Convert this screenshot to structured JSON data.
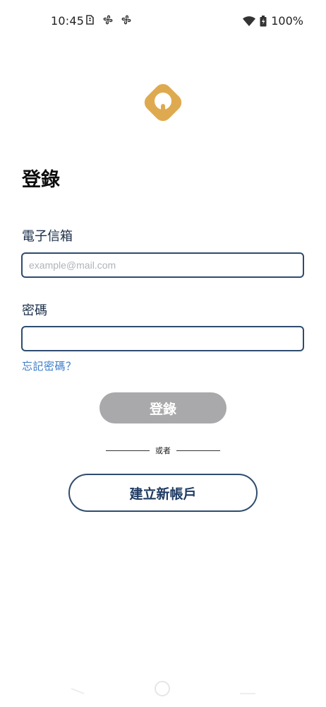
{
  "status_bar": {
    "time": "10:45",
    "battery": "100%",
    "icons": [
      "sim-icon",
      "fan-icon",
      "fan-icon",
      "wifi-icon",
      "battery-charging-icon"
    ]
  },
  "app": {
    "logo_icon": "app-logo-icon",
    "logo_color": "#DFAA4F"
  },
  "login": {
    "title": "登錄",
    "email_label": "電子信箱",
    "email_placeholder": "example@mail.com",
    "email_value": "",
    "password_label": "密碼",
    "password_value": "",
    "forgot_password": "忘記密碼？",
    "login_button": "登錄",
    "divider_text": "或者",
    "create_account_button": "建立新帳戶"
  },
  "colors": {
    "accent_navy": "#2F4C6E",
    "link_blue": "#3A7BC8",
    "button_disabled_gray": "#A9A9AB"
  }
}
